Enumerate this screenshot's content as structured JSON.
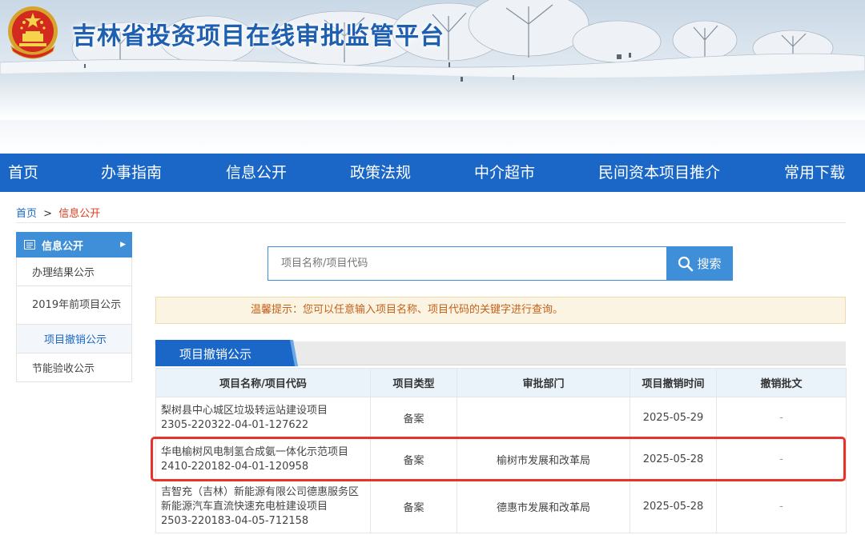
{
  "header": {
    "site_title": "吉林省投资项目在线审批监管平台",
    "emblem": "national-emblem"
  },
  "nav": {
    "items": [
      {
        "label": "首页"
      },
      {
        "label": "办事指南"
      },
      {
        "label": "信息公开"
      },
      {
        "label": "政策法规"
      },
      {
        "label": "中介超市"
      },
      {
        "label": "民间资本项目推介"
      },
      {
        "label": "常用下载"
      }
    ]
  },
  "breadcrumb": {
    "home": "首页",
    "separator": ">",
    "current": "信息公开"
  },
  "sidebar": {
    "title": "信息公开",
    "items": [
      {
        "label": "办理结果公示",
        "active": false
      },
      {
        "label": "2019年前项目公示",
        "active": false
      },
      {
        "label": "项目撤销公示",
        "active": true
      },
      {
        "label": "节能验收公示",
        "active": false
      }
    ]
  },
  "search": {
    "placeholder": "项目名称/项目代码",
    "button_label": "搜索"
  },
  "tip": {
    "text": "温馨提示：您可以任意输入项目名称、项目代码的关键字进行查询。"
  },
  "section": {
    "title": "项目撤销公示"
  },
  "table": {
    "headers": [
      "项目名称/项目代码",
      "项目类型",
      "审批部门",
      "项目撤销时间",
      "撤销批文"
    ],
    "rows": [
      {
        "name_lines": [
          "梨树县中心城区垃圾转运站建设项目",
          "2305-220322-04-01-127622"
        ],
        "type": "备案",
        "dept": "",
        "date": "2025-05-29",
        "doc": "-",
        "highlighted": false
      },
      {
        "name_lines": [
          "华电榆树风电制氢合成氨一体化示范项目",
          "2410-220182-04-01-120958"
        ],
        "type": "备案",
        "dept": "榆树市发展和改革局",
        "date": "2025-05-28",
        "doc": "-",
        "highlighted": true
      },
      {
        "name_lines": [
          "吉智充（吉林）新能源有限公司德惠服务区",
          "新能源汽车直流快速充电桩建设项目",
          "2503-220183-04-05-712158"
        ],
        "type": "备案",
        "dept": "德惠市发展和改革局",
        "date": "2025-05-28",
        "doc": "-",
        "highlighted": false
      }
    ]
  },
  "colors": {
    "nav_bg": "#1a67c7",
    "title": "#1f5fb0",
    "accent": "#3f8fd8",
    "breadcrumb_current": "#e03c1f",
    "tip_text": "#c2611b",
    "highlight": "#e8322a"
  }
}
